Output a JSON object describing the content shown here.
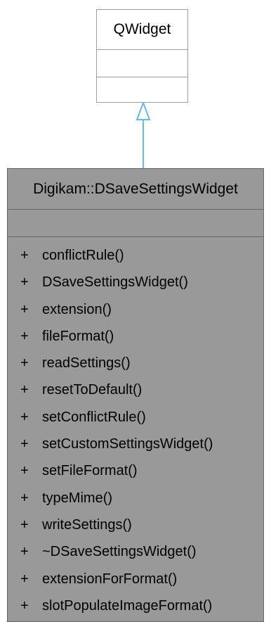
{
  "parent_class": {
    "name": "QWidget"
  },
  "child_class": {
    "name": "Digikam::DSaveSettingsWidget",
    "methods": [
      {
        "visibility": "+",
        "name": "conflictRule()"
      },
      {
        "visibility": "+",
        "name": "DSaveSettingsWidget()"
      },
      {
        "visibility": "+",
        "name": "extension()"
      },
      {
        "visibility": "+",
        "name": "fileFormat()"
      },
      {
        "visibility": "+",
        "name": "readSettings()"
      },
      {
        "visibility": "+",
        "name": "resetToDefault()"
      },
      {
        "visibility": "+",
        "name": "setConflictRule()"
      },
      {
        "visibility": "+",
        "name": "setCustomSettingsWidget()"
      },
      {
        "visibility": "+",
        "name": "setFileFormat()"
      },
      {
        "visibility": "+",
        "name": "typeMime()"
      },
      {
        "visibility": "+",
        "name": "writeSettings()"
      },
      {
        "visibility": "+",
        "name": "~DSaveSettingsWidget()"
      },
      {
        "visibility": "+",
        "name": "extensionForFormat()"
      },
      {
        "visibility": "+",
        "name": "slotPopulateImageFormat()"
      }
    ]
  },
  "colors": {
    "inheritance_arrow": "#63b8ff",
    "child_fill": "#999999",
    "parent_fill": "#ffffff"
  }
}
